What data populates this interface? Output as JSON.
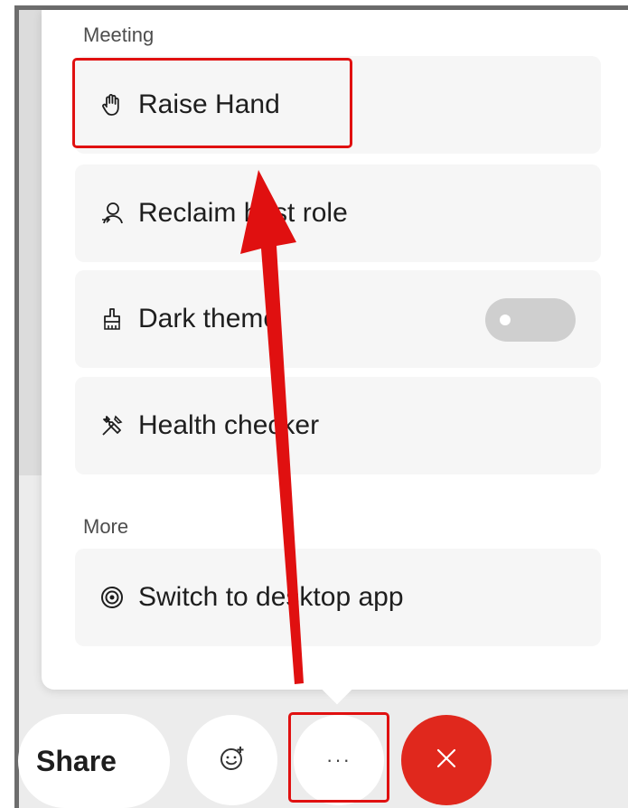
{
  "menu": {
    "sections": [
      {
        "title": "Meeting"
      },
      {
        "title": "More"
      }
    ],
    "items": [
      {
        "label": "Raise Hand",
        "icon": "raise-hand-icon"
      },
      {
        "label": "Reclaim host role",
        "icon": "person-reclaim-icon"
      },
      {
        "label": "Dark theme",
        "icon": "paint-brush-icon",
        "toggle": false
      },
      {
        "label": "Health checker",
        "icon": "tools-icon"
      },
      {
        "label": "Switch to desktop app",
        "icon": "desktop-app-icon"
      }
    ]
  },
  "controls": {
    "share_label": "Share",
    "reaction_icon": "smiley-add-icon",
    "more_label": "···",
    "end_icon": "close-icon"
  },
  "colors": {
    "annotation": "#e01010",
    "end_button": "#e0281d",
    "toggle_off": "#cfcfcf"
  }
}
